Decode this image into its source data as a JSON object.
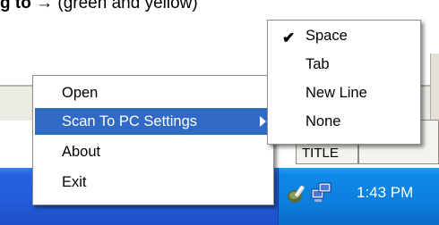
{
  "doc": {
    "text_bold": "g to",
    "arrow_label": "→",
    "text_plain": "(green and yellow)"
  },
  "table": {
    "title_cell": "TITLE"
  },
  "context_menu": {
    "items": [
      {
        "label": "Open"
      },
      {
        "label": "Scan To PC Settings",
        "highlighted": true,
        "has_submenu": true
      },
      {
        "label": "About"
      },
      {
        "label": "Exit"
      }
    ]
  },
  "submenu": {
    "items": [
      {
        "label": "Space",
        "checked": true
      },
      {
        "label": "Tab",
        "checked": false
      },
      {
        "label": "New Line",
        "checked": false
      },
      {
        "label": "None",
        "checked": false
      }
    ],
    "check_glyph": "✔"
  },
  "taskbar": {
    "clock": "1:43 PM",
    "tray_icons": [
      "tool-icon",
      "network-icon"
    ]
  },
  "colors": {
    "highlight": "#316ac5",
    "taskbar": "#245edb",
    "tray": "#0d8ae6"
  }
}
